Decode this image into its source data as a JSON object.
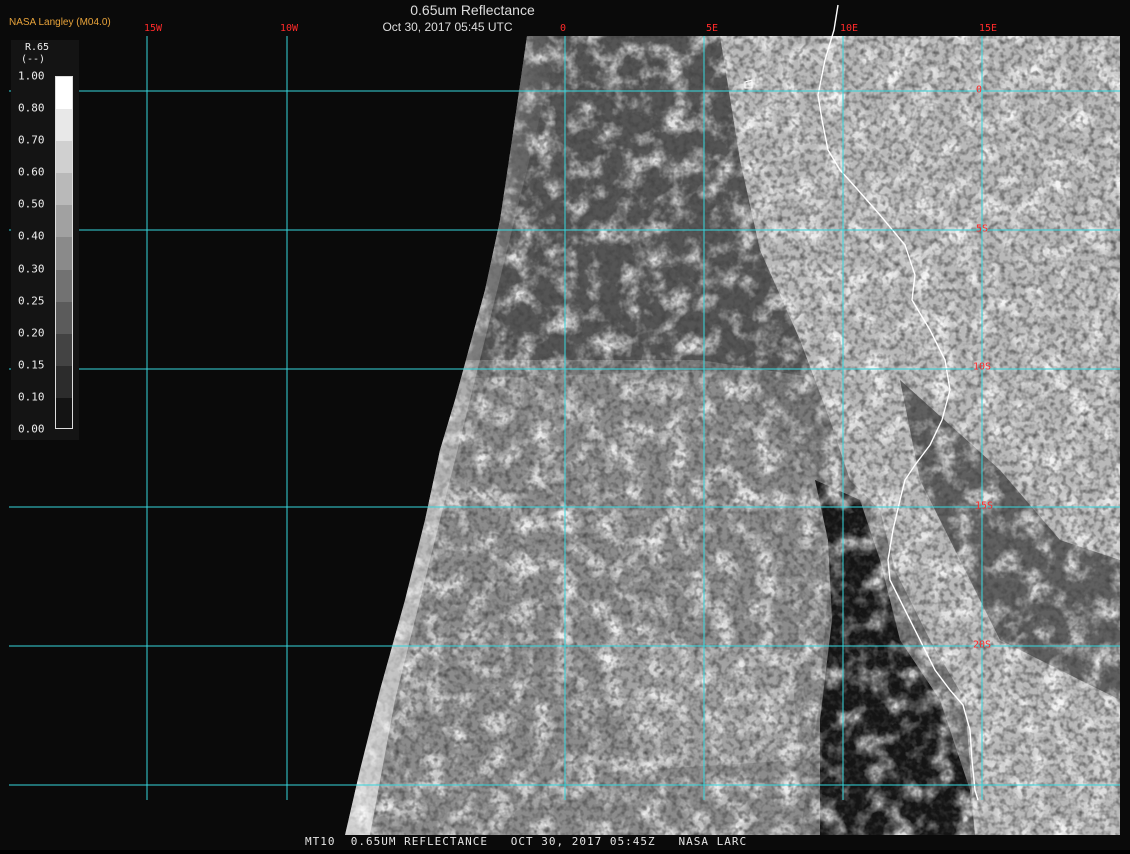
{
  "header": {
    "credit": "NASA Langley (M04.0)",
    "title": "0.65um Reflectance",
    "subtitle": "Oct 30, 2017 05:45 UTC"
  },
  "footer": {
    "caption": "MT10  0.65UM REFLECTANCE   OCT 30, 2017 05:45Z   NASA LARC"
  },
  "map": {
    "product": "0.65um visible reflectance",
    "grid_color": "#35d6dc",
    "label_color": "#ff2a2a",
    "coast_color": "#ffffff",
    "space_color": "#0a0a0a",
    "lon_labels": [
      "15W",
      "10W",
      "0",
      "5E",
      "10E",
      "15E"
    ],
    "lat_labels": [
      "0",
      "5S",
      "10S",
      "15S",
      "20S"
    ]
  },
  "legend": {
    "title": "R.65",
    "units": "(--)",
    "ticks": [
      "1.00",
      "0.80",
      "0.70",
      "0.60",
      "0.50",
      "0.40",
      "0.30",
      "0.25",
      "0.20",
      "0.15",
      "0.10",
      "0.00"
    ]
  }
}
